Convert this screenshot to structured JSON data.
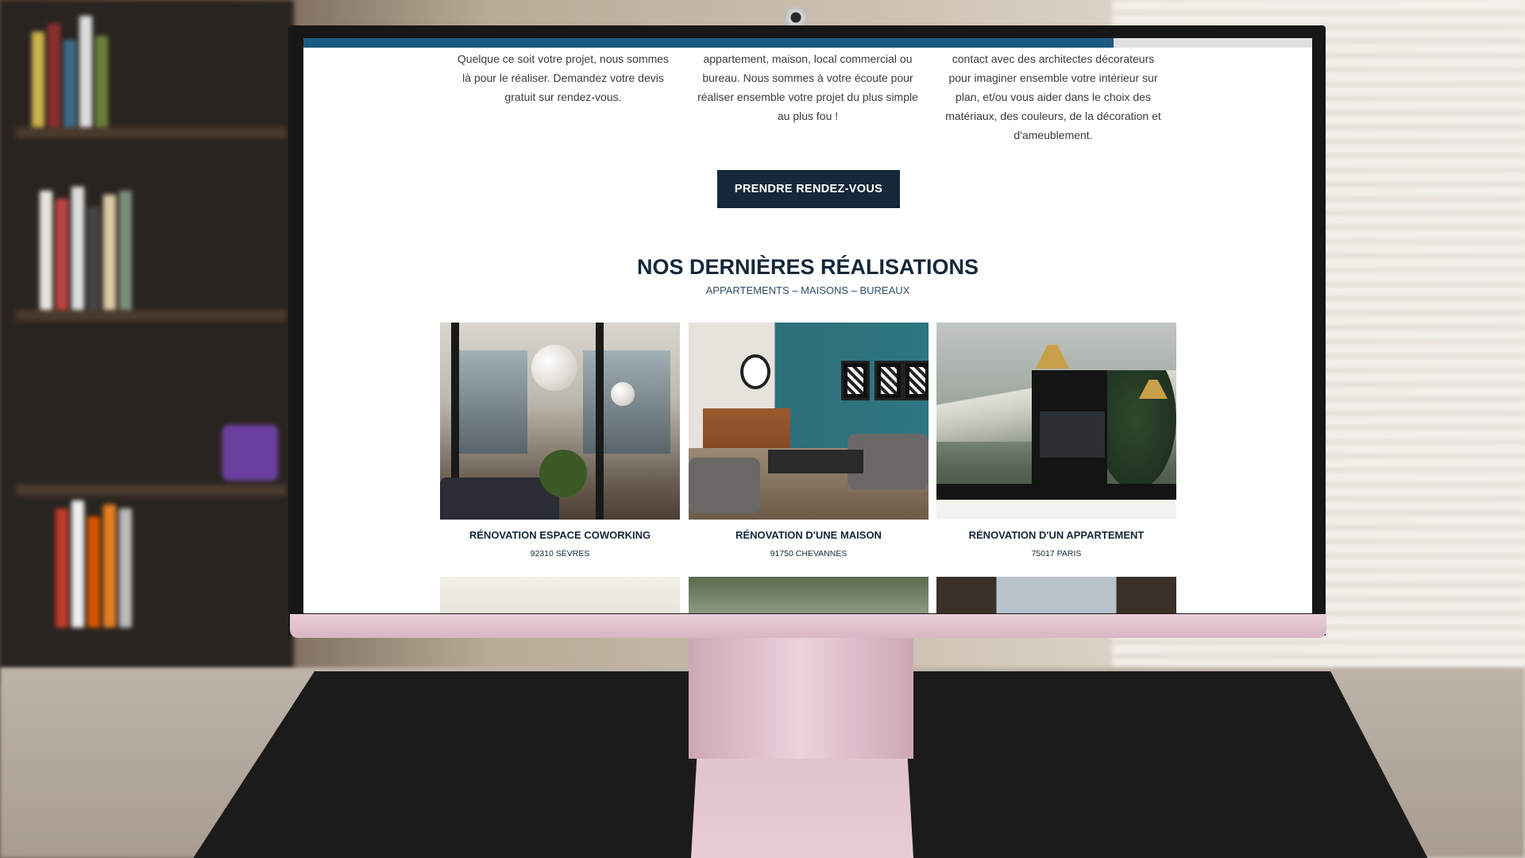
{
  "page": {
    "intro_columns": [
      {
        "text": "Quelque ce soit votre projet, nous sommes là pour le réaliser. Demandez votre devis gratuit sur rendez-vous."
      },
      {
        "text": "appartement, maison, local commercial ou bureau. Nous sommes à votre écoute pour réaliser ensemble votre projet du plus simple au plus fou !"
      },
      {
        "text": "contact avec des architectes décorateurs pour imaginer ensemble votre intérieur sur plan, et/ou vous aider dans le choix des matériaux, des couleurs, de la décoration et d'ameublement."
      }
    ],
    "cta_label": "PRENDRE RENDEZ-VOUS",
    "section_title": "NOS DERNIÈRES RÉALISATIONS",
    "section_subtitle": "APPARTEMENTS – MAISONS – BUREAUX",
    "projects": [
      {
        "title": "RÉNOVATION ESPACE COWORKING",
        "location": "92310 SÈVRES"
      },
      {
        "title": "RÉNOVATION D'UNE MAISON",
        "location": "91750 CHEVANNES"
      },
      {
        "title": "RÉNOVATION D'UN APPARTEMENT",
        "location": "75017 PARIS"
      }
    ]
  },
  "colors": {
    "primary": "#14283a",
    "topbar": "#1d5a80",
    "text": "#3b3b3b",
    "monitor_frame": "#e9cfd8"
  }
}
